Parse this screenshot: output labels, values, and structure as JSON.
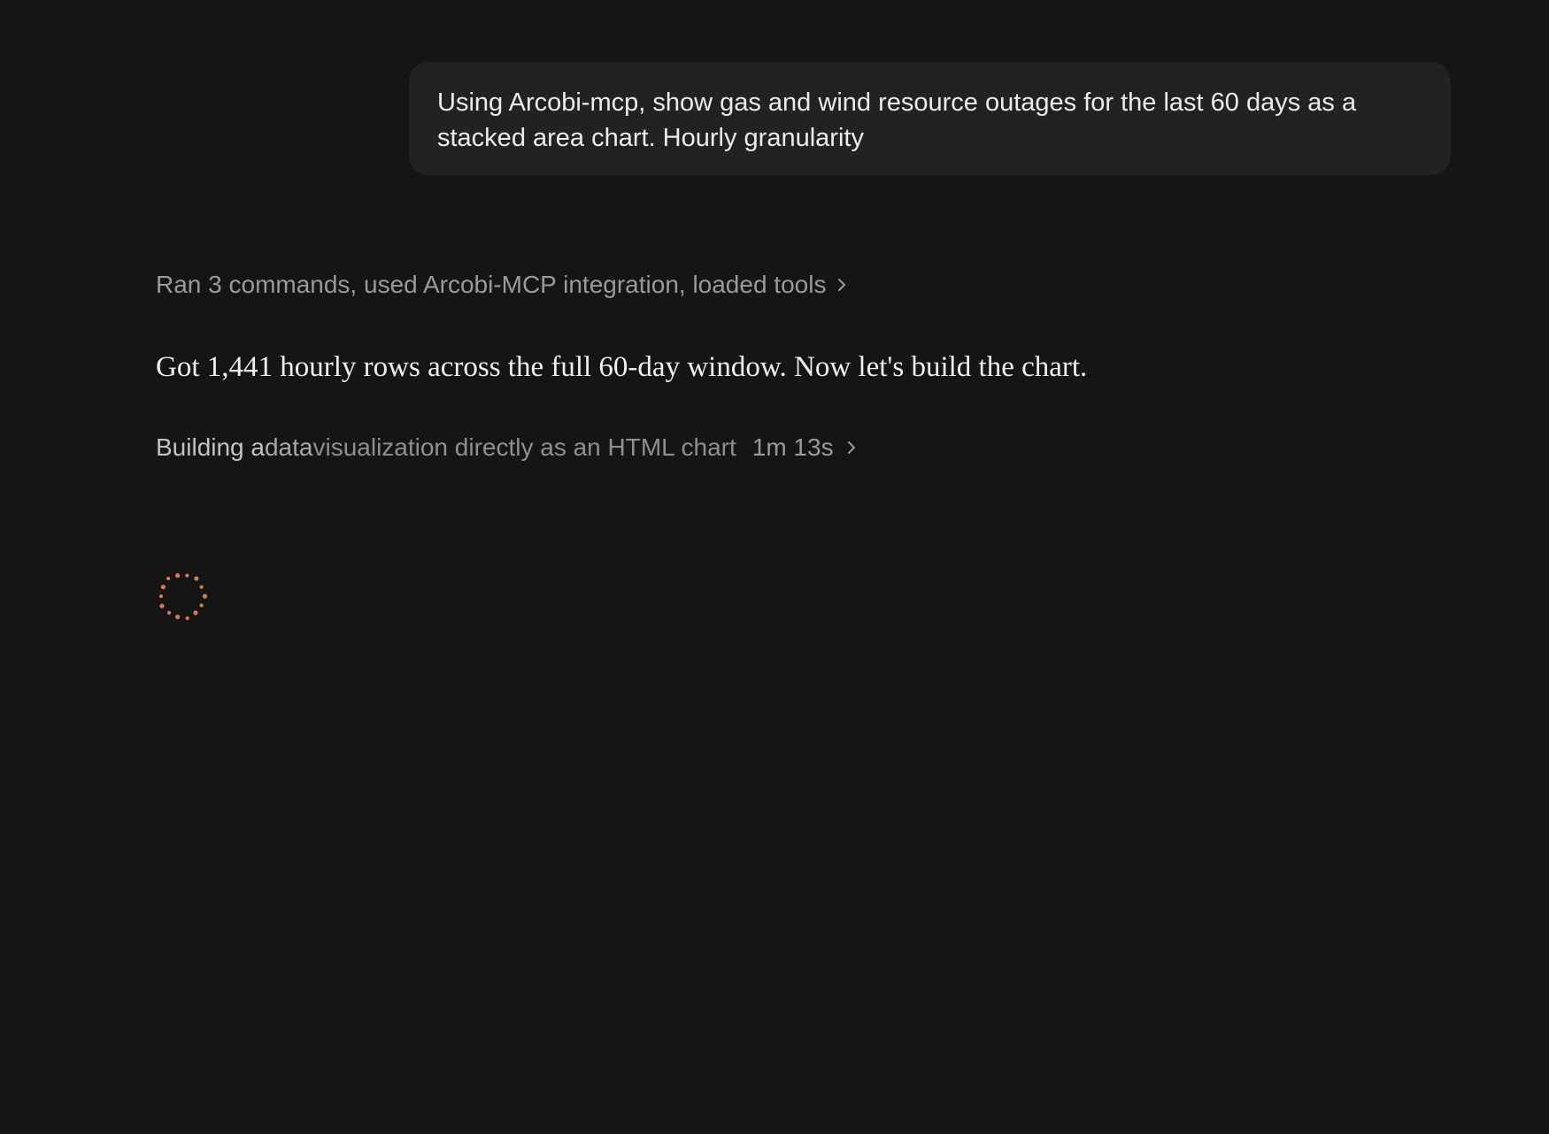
{
  "user_message": {
    "text": "Using Arcobi-mcp, show gas and wind resource outages for the last 60 days as a stacked area chart. Hourly granularity"
  },
  "steps_summary": {
    "label": "Ran 3 commands, used Arcobi-MCP integration, loaded tools",
    "icon": "chevron-right-icon"
  },
  "assistant_message": {
    "text": "Got 1,441 hourly rows across the full 60-day window. Now let's build the chart."
  },
  "building_status": {
    "label_part1": "Building a ",
    "label_part2": "data ",
    "label_part3": "visualization directly as an HTML chart",
    "elapsed": "1m 13s",
    "icon": "chevron-right-icon"
  },
  "spinner": {
    "icon": "loading-spinner-icon",
    "color": "#d9795a"
  }
}
